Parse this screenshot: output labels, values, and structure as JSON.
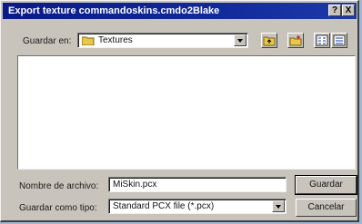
{
  "window": {
    "title": "Export texture commandoskins.cmdo2Blake",
    "help_label": "?",
    "close_label": "X"
  },
  "save_in": {
    "label": "Guardar en:",
    "value": "Textures"
  },
  "filename": {
    "label": "Nombre de archivo:",
    "value": "MiSkin.pcx"
  },
  "filetype": {
    "label": "Guardar como tipo:",
    "value": "Standard PCX file (*.pcx)"
  },
  "buttons": {
    "save": "Guardar",
    "cancel": "Cancelar"
  },
  "icons": [
    "folder-icon",
    "up-folder-icon",
    "new-folder-icon",
    "list-view-icon",
    "details-view-icon",
    "chevron-down-icon"
  ]
}
